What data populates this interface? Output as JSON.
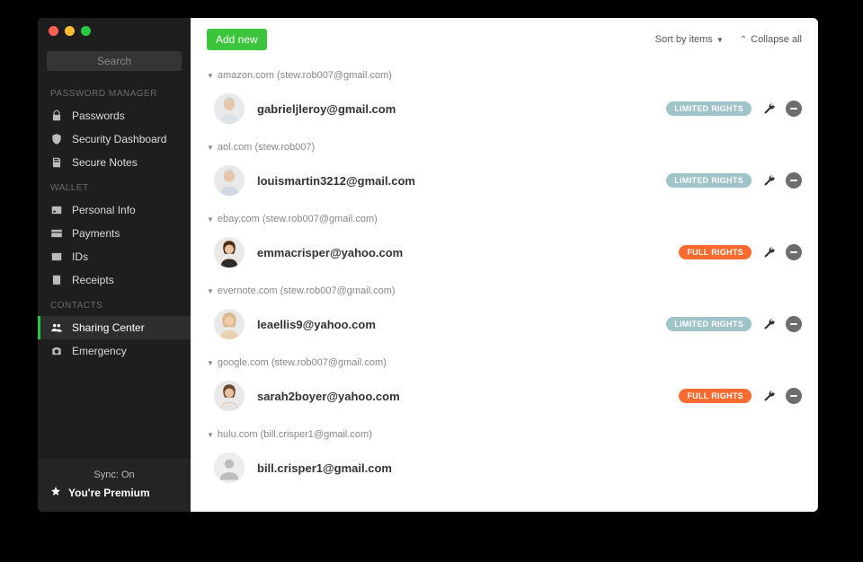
{
  "search_placeholder": "Search",
  "sidebar": {
    "sections": [
      {
        "title": "PASSWORD MANAGER",
        "items": [
          {
            "label": "Passwords",
            "icon": "lock-icon",
            "active": false
          },
          {
            "label": "Security Dashboard",
            "icon": "shield-icon",
            "active": false
          },
          {
            "label": "Secure Notes",
            "icon": "note-icon",
            "active": false
          }
        ]
      },
      {
        "title": "WALLET",
        "items": [
          {
            "label": "Personal Info",
            "icon": "person-card-icon",
            "active": false
          },
          {
            "label": "Payments",
            "icon": "card-icon",
            "active": false
          },
          {
            "label": "IDs",
            "icon": "id-icon",
            "active": false
          },
          {
            "label": "Receipts",
            "icon": "receipt-icon",
            "active": false
          }
        ]
      },
      {
        "title": "CONTACTS",
        "items": [
          {
            "label": "Sharing Center",
            "icon": "people-icon",
            "active": true
          },
          {
            "label": "Emergency",
            "icon": "camera-icon",
            "active": false
          }
        ]
      }
    ]
  },
  "footer": {
    "sync": "Sync: On",
    "premium": "You're Premium"
  },
  "toolbar": {
    "add_label": "Add new",
    "sort_label": "Sort by items",
    "collapse_label": "Collapse all"
  },
  "groups": [
    {
      "header": "amazon.com (stew.rob007@gmail.com)",
      "rows": [
        {
          "email": "gabrieljleroy@gmail.com",
          "rights": "LIMITED RIGHTS",
          "rights_type": "limited",
          "avatar": "man1"
        }
      ]
    },
    {
      "header": "aol.com (stew.rob007)",
      "rows": [
        {
          "email": "louismartin3212@gmail.com",
          "rights": "LIMITED RIGHTS",
          "rights_type": "limited",
          "avatar": "man2"
        }
      ]
    },
    {
      "header": "ebay.com (stew.rob007@gmail.com)",
      "rows": [
        {
          "email": "emmacrisper@yahoo.com",
          "rights": "FULL RIGHTS",
          "rights_type": "full",
          "avatar": "woman1"
        }
      ]
    },
    {
      "header": "evernote.com (stew.rob007@gmail.com)",
      "rows": [
        {
          "email": "leaellis9@yahoo.com",
          "rights": "LIMITED RIGHTS",
          "rights_type": "limited",
          "avatar": "woman2"
        }
      ]
    },
    {
      "header": "google.com (stew.rob007@gmail.com)",
      "rows": [
        {
          "email": "sarah2boyer@yahoo.com",
          "rights": "FULL RIGHTS",
          "rights_type": "full",
          "avatar": "woman3"
        }
      ]
    },
    {
      "header": "hulu.com (bill.crisper1@gmail.com)",
      "rows": [
        {
          "email": "bill.crisper1@gmail.com",
          "rights": "",
          "rights_type": "",
          "avatar": "placeholder"
        }
      ]
    }
  ],
  "colors": {
    "accent_green": "#3cc53c",
    "badge_limited": "#9ec3c9",
    "badge_full": "#ff6a2f"
  }
}
